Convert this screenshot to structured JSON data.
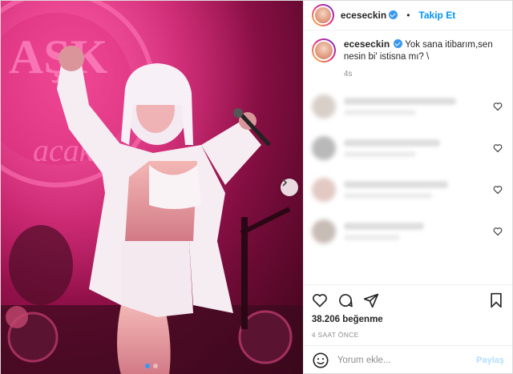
{
  "colors": {
    "accent": "#0095f6",
    "verified": "#3897f0",
    "muted": "#8e8e8e",
    "text": "#262626"
  },
  "photo": {
    "banner_text": "AŞK",
    "banner_sub": "acak",
    "icons": {
      "next": "chevron-right-icon"
    }
  },
  "header": {
    "username": "eceseckin",
    "separator": "•",
    "follow_label": "Takip Et"
  },
  "caption": {
    "username": "eceseckin",
    "text": "Yok sana itibarım,sen nesin bi' istisna mı? \\",
    "time": "4s"
  },
  "actions": {
    "icons": [
      "heart-icon",
      "comment-icon",
      "share-icon",
      "bookmark-icon"
    ]
  },
  "likes": {
    "count": "38.206",
    "label": "beğenme"
  },
  "timestamp": "4 SAAT ÖNCE",
  "add_comment": {
    "placeholder": "Yorum ekle...",
    "post_label": "Paylaş",
    "icon": "emoji-icon"
  }
}
